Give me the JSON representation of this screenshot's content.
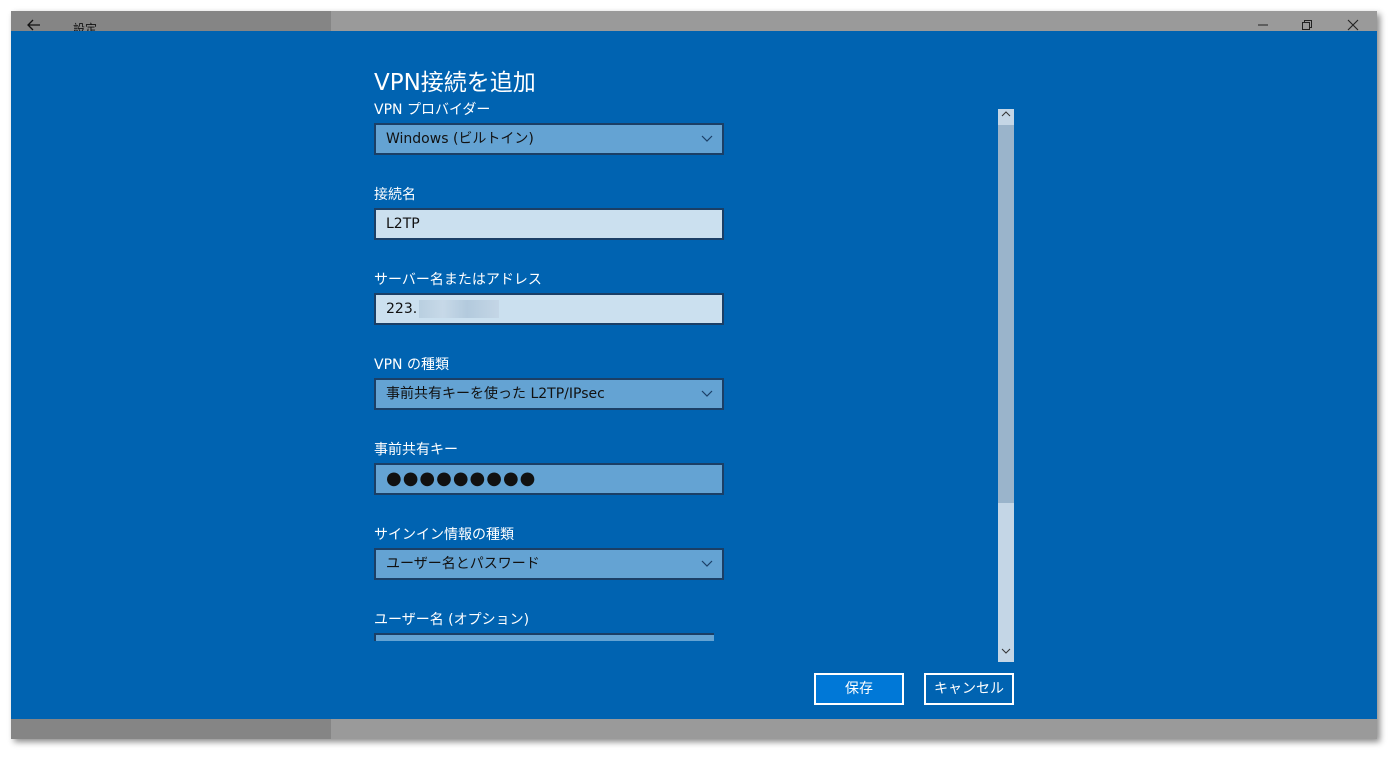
{
  "window": {
    "title": "設定",
    "back_icon": "back-arrow-icon"
  },
  "dialog": {
    "title": "VPN接続を追加",
    "fields": {
      "provider": {
        "label": "VPN プロバイダー",
        "value": "Windows (ビルトイン)"
      },
      "connection_name": {
        "label": "接続名",
        "value": "L2TP"
      },
      "server": {
        "label": "サーバー名またはアドレス",
        "value": "223."
      },
      "vpn_type": {
        "label": "VPN の種類",
        "value": "事前共有キーを使った L2TP/IPsec"
      },
      "psk": {
        "label": "事前共有キー",
        "value": "●●●●●●●●●"
      },
      "signin_type": {
        "label": "サインイン情報の種類",
        "value": "ユーザー名とパスワード"
      },
      "username": {
        "label": "ユーザー名 (オプション)",
        "value": ""
      }
    },
    "buttons": {
      "save": "保存",
      "cancel": "キャンセル"
    }
  },
  "colors": {
    "overlay": "#0063b1",
    "select_bg": "#64a3d3",
    "text_bg": "#cbe0ef"
  }
}
